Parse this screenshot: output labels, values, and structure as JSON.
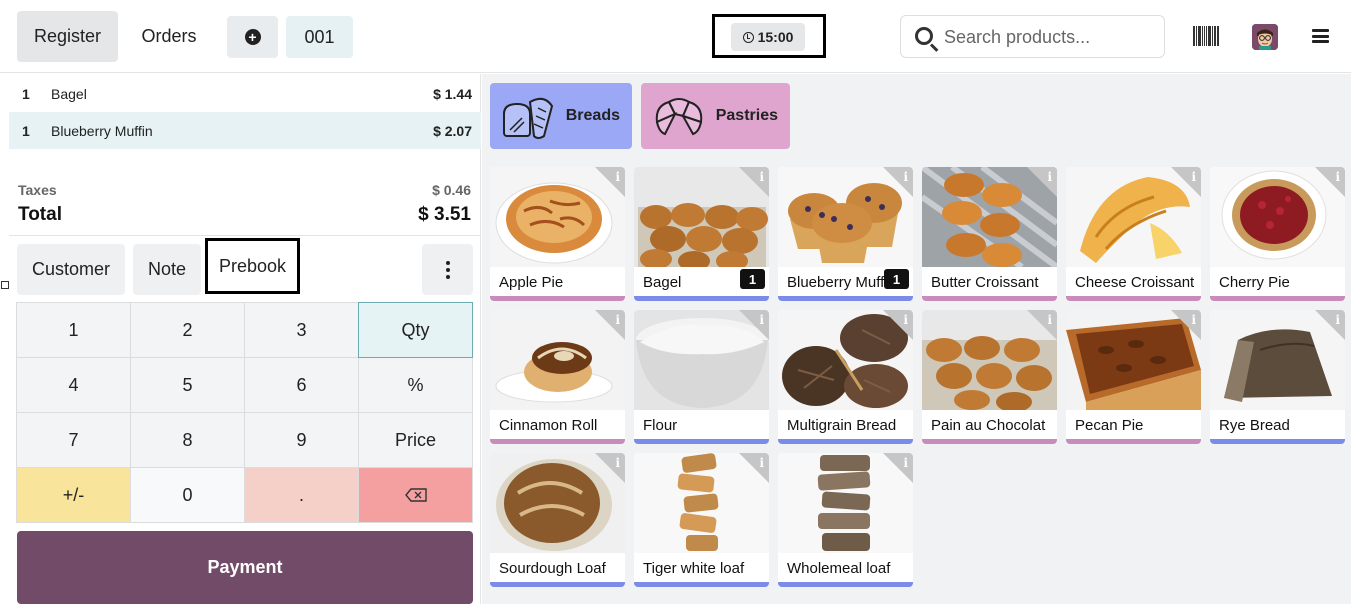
{
  "topbar": {
    "register_label": "Register",
    "orders_label": "Orders",
    "order_number": "001",
    "clock_time": "15:00",
    "search_placeholder": "Search products..."
  },
  "order": {
    "lines": [
      {
        "qty": "1",
        "name": "Bagel",
        "price": "$ 1.44"
      },
      {
        "qty": "1",
        "name": "Blueberry Muffin",
        "price": "$ 2.07"
      }
    ],
    "taxes_label": "Taxes",
    "taxes_value": "$ 0.46",
    "total_label": "Total",
    "total_value": "$ 3.51"
  },
  "controls": {
    "customer_label": "Customer",
    "note_label": "Note",
    "prebook_label": "Prebook"
  },
  "numpad": {
    "keys": [
      "1",
      "2",
      "3",
      "Qty",
      "4",
      "5",
      "6",
      "%",
      "7",
      "8",
      "9",
      "Price",
      "+/-",
      "0",
      "."
    ]
  },
  "payment_label": "Payment",
  "categories": [
    {
      "label": "Breads",
      "color": "#9aa8f5"
    },
    {
      "label": "Pastries",
      "color": "#dfa5ce"
    }
  ],
  "products": [
    {
      "name": "Apple Pie",
      "bar_color": "#c88cba",
      "badge": ""
    },
    {
      "name": "Bagel",
      "bar_color": "#7b8ce8",
      "badge": "1"
    },
    {
      "name": "Blueberry Muffin",
      "bar_color": "#7b8ce8",
      "badge": "1"
    },
    {
      "name": "Butter Croissant",
      "bar_color": "#c88cba",
      "badge": ""
    },
    {
      "name": "Cheese Croissant",
      "bar_color": "#c88cba",
      "badge": ""
    },
    {
      "name": "Cherry Pie",
      "bar_color": "#c88cba",
      "badge": ""
    },
    {
      "name": "Cinnamon Roll",
      "bar_color": "#c88cba",
      "badge": ""
    },
    {
      "name": "Flour",
      "bar_color": "#7b8ce8",
      "badge": ""
    },
    {
      "name": "Multigrain Bread",
      "bar_color": "#7b8ce8",
      "badge": ""
    },
    {
      "name": "Pain au Chocolat",
      "bar_color": "#c88cba",
      "badge": ""
    },
    {
      "name": "Pecan Pie",
      "bar_color": "#c88cba",
      "badge": ""
    },
    {
      "name": "Rye Bread",
      "bar_color": "#7b8ce8",
      "badge": ""
    },
    {
      "name": "Sourdough Loaf",
      "bar_color": "#7b8ce8",
      "badge": ""
    },
    {
      "name": "Tiger white loaf",
      "bar_color": "#7b8ce8",
      "badge": ""
    },
    {
      "name": "Wholemeal loaf",
      "bar_color": "#7b8ce8",
      "badge": ""
    }
  ]
}
